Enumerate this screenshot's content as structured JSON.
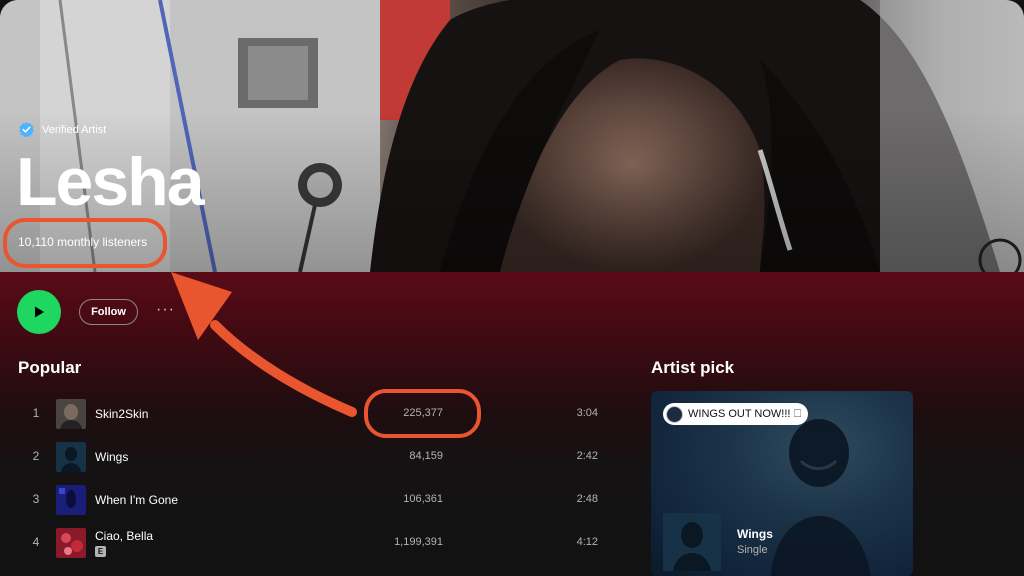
{
  "artist": {
    "verified_label": "Verified Artist",
    "name": "Lesha",
    "monthly_listeners": "10,110 monthly listeners"
  },
  "controls": {
    "follow_label": "Follow",
    "more_label": "···"
  },
  "popular": {
    "title": "Popular",
    "tracks": [
      {
        "num": "1",
        "title": "Skin2Skin",
        "plays": "225,377",
        "duration": "3:04",
        "explicit": false
      },
      {
        "num": "2",
        "title": "Wings",
        "plays": "84,159",
        "duration": "2:42",
        "explicit": false
      },
      {
        "num": "3",
        "title": "When I'm Gone",
        "plays": "106,361",
        "duration": "2:48",
        "explicit": false
      },
      {
        "num": "4",
        "title": "Ciao, Bella",
        "plays": "1,199,391",
        "duration": "4:12",
        "explicit": true,
        "explicit_label": "E"
      }
    ]
  },
  "artist_pick": {
    "title": "Artist pick",
    "badge_text": "WINGS OUT NOW!!! 🗆",
    "release_name": "Wings",
    "release_type": "Single"
  },
  "colors": {
    "accent_green": "#1ed760",
    "annotation_orange": "#e8552e",
    "background": "#121212",
    "header_maroon": "#5a0b16"
  }
}
